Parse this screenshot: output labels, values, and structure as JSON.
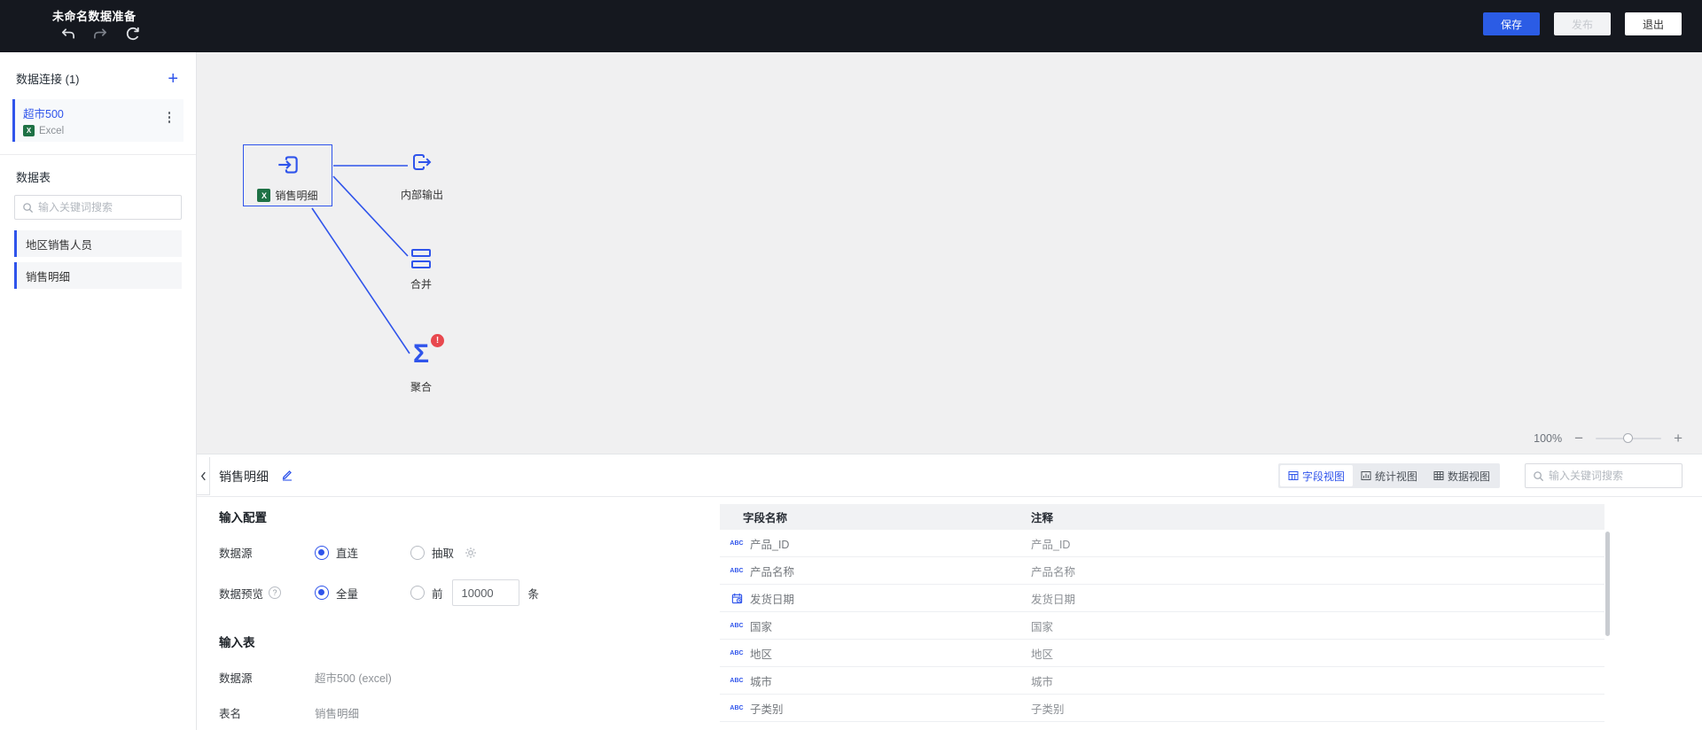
{
  "topbar": {
    "title": "未命名数据准备",
    "save_label": "保存",
    "publish_label": "发布",
    "exit_label": "退出"
  },
  "sidebar": {
    "connections_header": "数据连接 (1)",
    "connection_name": "超市500",
    "connection_type": "Excel",
    "tables_header": "数据表",
    "search_placeholder": "输入关键词搜索",
    "tables": [
      {
        "name": "地区销售人员"
      },
      {
        "name": "销售明细"
      }
    ]
  },
  "canvas": {
    "input_node_label": "销售明细",
    "output_node_label": "内部输出",
    "merge_node_label": "合并",
    "aggregate_node_label": "聚合",
    "zoom_level": "100%"
  },
  "panel": {
    "title": "销售明细",
    "view_field": "字段视图",
    "view_stats": "统计视图",
    "view_data": "数据视图",
    "active_view": "字段视图",
    "search_placeholder": "输入关键词搜索",
    "input_config_title": "输入配置",
    "datasource_label": "数据源",
    "direct_label": "直连",
    "extract_label": "抽取",
    "preview_label": "数据预览",
    "full_label": "全量",
    "front_label": "前",
    "limit_value": "10000",
    "unit_label": "条",
    "input_table_title": "输入表",
    "table_datasource_label": "数据源",
    "table_datasource_value": "超市500 (excel)",
    "table_name_label": "表名",
    "table_name_value": "销售明细",
    "fields": {
      "header_name": "字段名称",
      "header_comment": "注释",
      "rows": [
        {
          "type": "string",
          "name": "产品_ID",
          "comment": "产品_ID"
        },
        {
          "type": "string",
          "name": "产品名称",
          "comment": "产品名称"
        },
        {
          "type": "date",
          "name": "发货日期",
          "comment": "发货日期"
        },
        {
          "type": "string",
          "name": "国家",
          "comment": "国家"
        },
        {
          "type": "string",
          "name": "地区",
          "comment": "地区"
        },
        {
          "type": "string",
          "name": "城市",
          "comment": "城市"
        },
        {
          "type": "string",
          "name": "子类别",
          "comment": "子类别"
        }
      ]
    }
  },
  "icons": {
    "plus": "+",
    "minus": "−",
    "sigma": "Σ",
    "error_mark": "!",
    "help_mark": "?",
    "string_type": "ABC",
    "excel_letter": "X"
  },
  "colors": {
    "accent": "#2f54eb",
    "save_button": "#2b5ce5",
    "error": "#e8484e",
    "excel_green": "#1e7145",
    "topbar_bg": "#15181f"
  }
}
